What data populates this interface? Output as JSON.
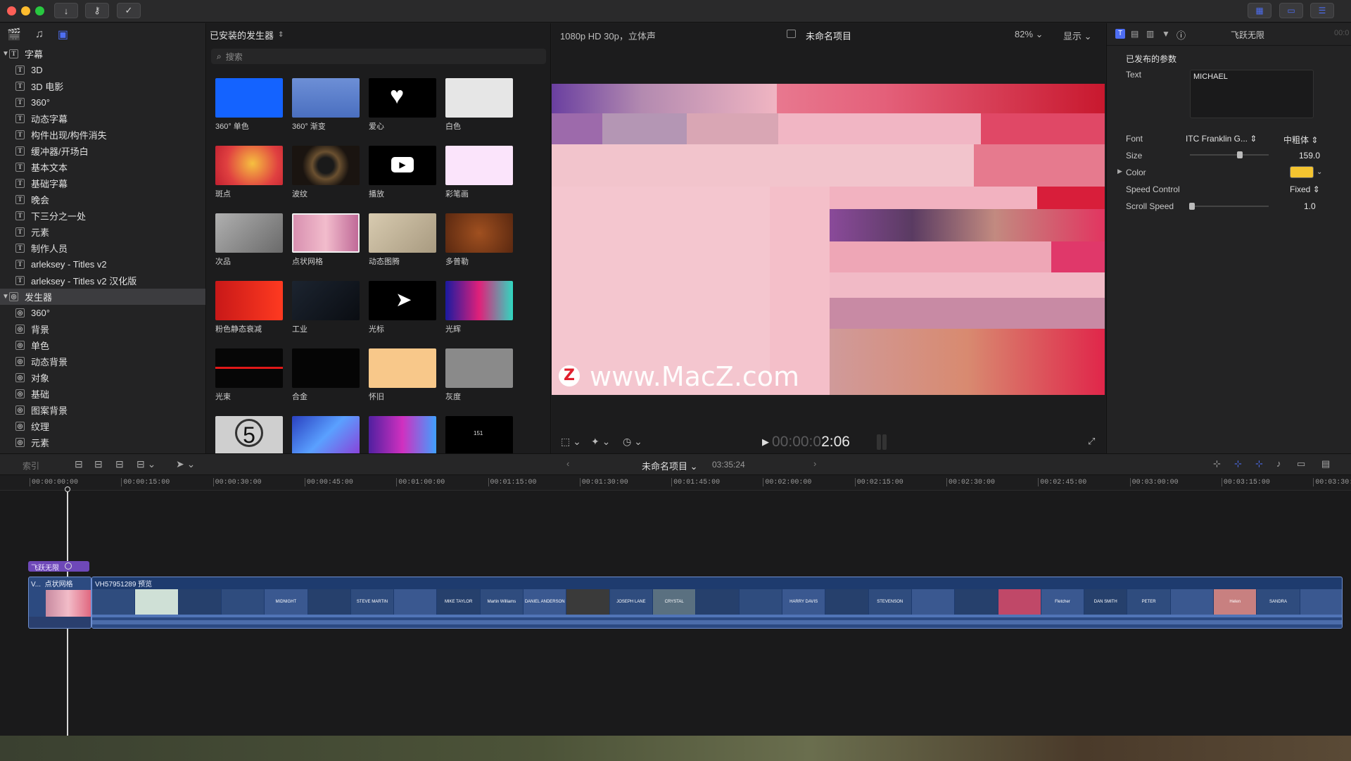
{
  "titlebar": {
    "download_icon": "download-icon",
    "key_icon": "key-icon",
    "check_icon": "check-icon"
  },
  "sidebar": {
    "sections": [
      {
        "label": "字幕",
        "items": [
          "3D",
          "3D 电影",
          "360°",
          "动态字幕",
          "构件出现/构件消失",
          "缓冲器/开场白",
          "基本文本",
          "基础字幕",
          "晚会",
          "下三分之一处",
          "元素",
          "制作人员",
          "arleksey - Titles v2",
          "arleksey - Titles v2 汉化版"
        ]
      },
      {
        "label": "发生器",
        "items": [
          "360°",
          "背景",
          "单色",
          "动态背景",
          "对象",
          "基础",
          "图案背景",
          "纹理",
          "元素"
        ]
      }
    ]
  },
  "generators": {
    "title": "已安装的发生器",
    "search_placeholder": "搜索",
    "items": [
      {
        "label": "360° 单色"
      },
      {
        "label": "360° 渐变"
      },
      {
        "label": "爱心"
      },
      {
        "label": "白色"
      },
      {
        "label": "斑点"
      },
      {
        "label": "波纹"
      },
      {
        "label": "播放"
      },
      {
        "label": "彩笔画"
      },
      {
        "label": "次品"
      },
      {
        "label": "点状网格"
      },
      {
        "label": "动态图腾"
      },
      {
        "label": "多普勒"
      },
      {
        "label": "粉色静态衰减"
      },
      {
        "label": "工业"
      },
      {
        "label": "光标"
      },
      {
        "label": "光辉"
      },
      {
        "label": "光束"
      },
      {
        "label": "合金"
      },
      {
        "label": "怀旧"
      },
      {
        "label": "灰度"
      },
      {
        "label": ""
      },
      {
        "label": ""
      },
      {
        "label": ""
      },
      {
        "label": ""
      }
    ],
    "countdown_number": "5",
    "tiny_label": "151"
  },
  "viewer": {
    "format": "1080p HD 30p，立体声",
    "project": "未命名项目",
    "zoom": "82%",
    "display": "显示",
    "watermark": "www.MacZ.com",
    "watermark_letter": "Z",
    "timecode_dim": "00:00:0",
    "timecode_bright": "2:06"
  },
  "inspector": {
    "header_title": "飞跃无限",
    "header_right": "00:0",
    "section": "已发布的参数",
    "text_label": "Text",
    "text_value": "MICHAEL",
    "font_label": "Font",
    "font_value": "ITC Franklin G...",
    "font_weight": "中粗体",
    "size_label": "Size",
    "size_value": "159.0",
    "size_fraction": 0.63,
    "color_label": "Color",
    "color_value": "#f4c430",
    "speed_control_label": "Speed Control",
    "speed_control_value": "Fixed",
    "scroll_speed_label": "Scroll Speed",
    "scroll_speed_value": "1.0",
    "scroll_fraction": 0.03
  },
  "timeline": {
    "index_label": "索引",
    "project": "未命名项目",
    "duration": "03:35:24",
    "ticks": [
      "00:00:00:00",
      "00:00:15:00",
      "00:00:30:00",
      "00:00:45:00",
      "00:01:00:00",
      "00:01:15:00",
      "00:01:30:00",
      "00:01:45:00",
      "00:02:00:00",
      "00:02:15:00",
      "00:02:30:00",
      "00:02:45:00",
      "00:03:00:00",
      "00:03:15:00",
      "00:03:30:"
    ],
    "title_clip": "飞跃无限",
    "clip_a_prefix": "V...",
    "clip_a_name": "点状网格",
    "clip_b_name": "VH57951289 预览",
    "strip_labels": [
      "",
      "",
      "",
      "",
      "MIDNIGHT",
      "",
      "STEVE MARTIN",
      "",
      "MIKE TAYLOR",
      "Martin Williams",
      "DANIEL ANDERSON",
      "",
      "JOSEPH LANE",
      "CRYSTAL",
      "",
      "",
      "HARRY DAVIS",
      "",
      "STEVENSON",
      "",
      "",
      "",
      "Fletcher",
      "DAN SMITH",
      "PETER",
      "",
      "Helen",
      "SANDRA",
      ""
    ]
  }
}
